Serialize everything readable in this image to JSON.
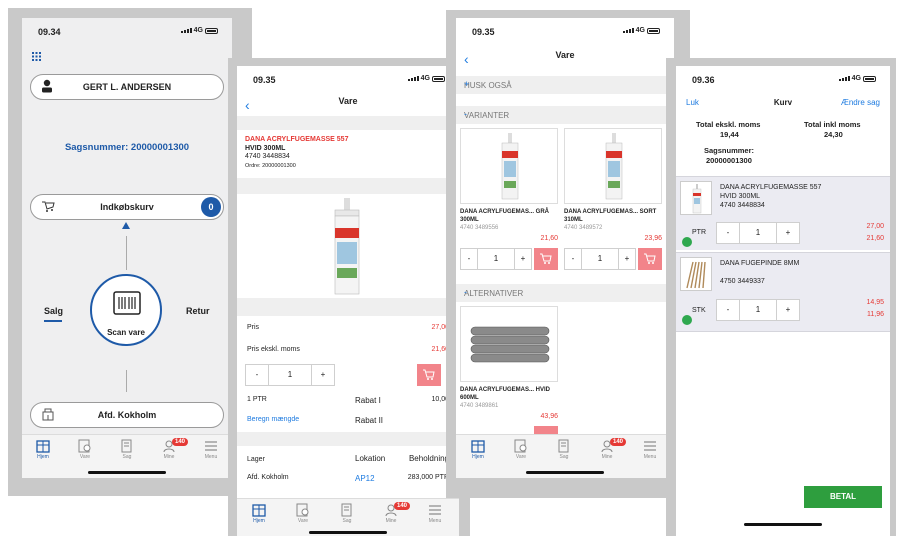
{
  "brand_colors": {
    "blue": "#1e5aa8",
    "link_blue": "#1e7be0",
    "red": "#e53935",
    "green": "#2e9e3e"
  },
  "tabbar": [
    {
      "label": "Hjem",
      "icon": "home-icon"
    },
    {
      "label": "Vare",
      "icon": "product-search-icon"
    },
    {
      "label": "Sag",
      "icon": "case-icon"
    },
    {
      "label": "Mine",
      "icon": "user-icon",
      "badge": "140"
    },
    {
      "label": "Menu",
      "icon": "hamburger-menu-icon"
    }
  ],
  "screen1": {
    "time": "09.34",
    "network": "4G",
    "user_name": "GERT L. ANDERSEN",
    "case_text": "Sagsnummer: 20000001300",
    "basket_label": "Indkøbskurv",
    "basket_count": "0",
    "left_label": "Salg",
    "right_label": "Retur",
    "scan_label": "Scan vare",
    "department": "Afd. Kokholm"
  },
  "screen2": {
    "time": "09.35",
    "network": "4G",
    "title": "Vare",
    "product_name": "DANA ACRYLFUGEMASSE 557",
    "product_variant": "HVID 300ML",
    "product_number": "4740 3448834",
    "order_line": "Ordre: 20000001300",
    "price_label": "Pris",
    "price_value": "27,00",
    "price_ex_label": "Pris ekskl. moms",
    "price_ex_value": "21,60",
    "quantity": "1",
    "minus": "-",
    "plus": "+",
    "unit_label": "1 PTR",
    "rabat1_label": "Rabat I",
    "rabat1_value": "10,00",
    "calc_link": "Beregn mængde",
    "rabat2_label": "Rabat II",
    "stock_headers": [
      "Lager",
      "Lokation",
      "Beholdning"
    ],
    "stock_row": [
      "Afd. Kokholm",
      "AP12",
      "283,000 PTR"
    ]
  },
  "screen3": {
    "time": "09.35",
    "network": "4G",
    "title": "Vare",
    "section_remember": "HUSK OGSÅ",
    "section_variants": "VARIANTER",
    "section_alternatives": "ALTERNATIVER",
    "toggle_plus": "+",
    "toggle_minus": "-",
    "variants": [
      {
        "name": "DANA ACRYLFUGEMAS... GRÅ 300ML",
        "number": "4740 3489556",
        "price": "21,60",
        "quantity": "1"
      },
      {
        "name": "DANA ACRYLFUGEMAS... SORT 310ML",
        "number": "4740 3489572",
        "price": "23,96",
        "quantity": "1"
      }
    ],
    "alternatives": [
      {
        "name": "DANA ACRYLFUGEMAS... HVID 600ML",
        "number": "4740 3489861",
        "price": "43,96"
      }
    ]
  },
  "screen4": {
    "time": "09.36",
    "network": "4G",
    "close_label": "Luk",
    "title": "Kurv",
    "change_case_label": "Ændre sag",
    "total_ex_label": "Total ekskl. moms",
    "total_ex_value": "19,44",
    "total_in_label": "Total inkl moms",
    "total_in_value": "24,30",
    "case_label": "Sagsnummer:",
    "case_value": "20000001300",
    "items": [
      {
        "name": "DANA ACRYLFUGEMASSE 557",
        "variant": "HVID 300ML",
        "number": "4740 3448834",
        "unit": "PTR",
        "quantity": "1",
        "price": "27,00",
        "price_ex": "21,60"
      },
      {
        "name": "DANA FUGEPINDE 8MM",
        "variant": "",
        "number": "4750 3449337",
        "unit": "STK",
        "quantity": "1",
        "price": "14,95",
        "price_ex": "11,96"
      }
    ],
    "pay_label": "BETAL"
  }
}
